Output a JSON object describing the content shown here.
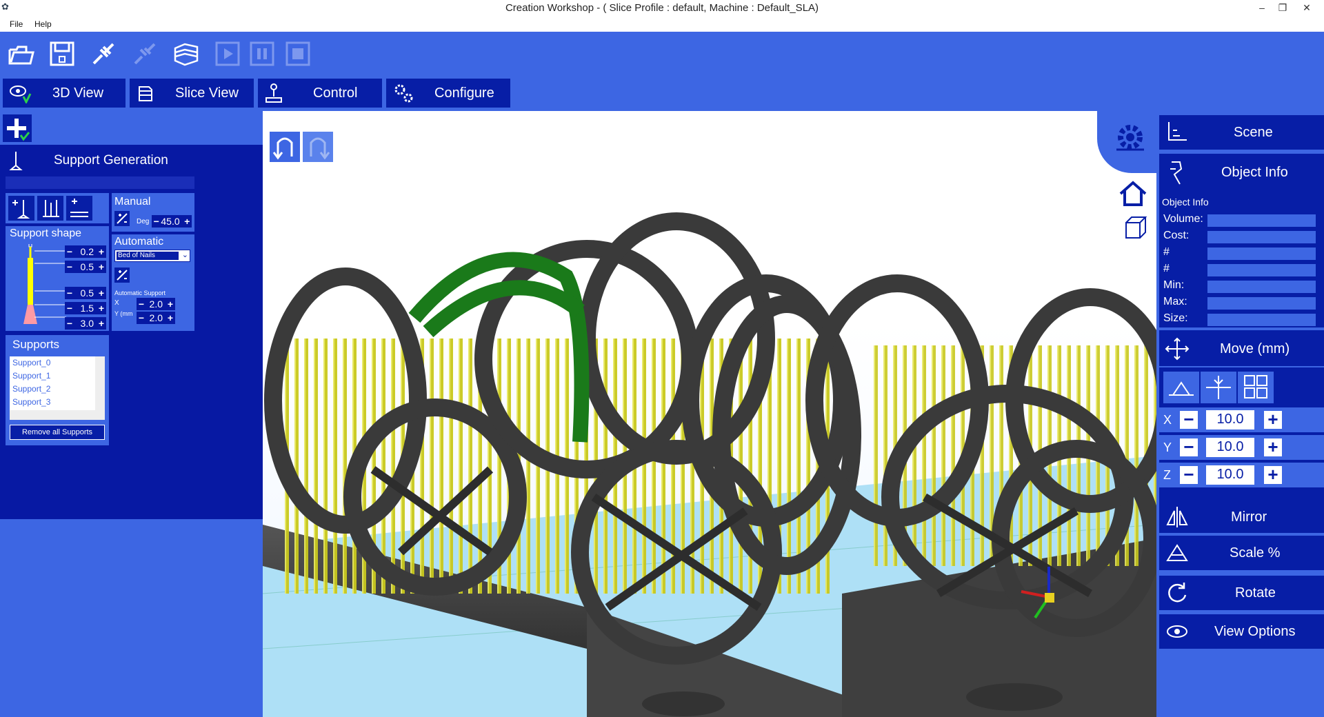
{
  "window": {
    "title": "Creation Workshop -    ( Slice Profile : default, Machine : Default_SLA)",
    "min": "–",
    "max": "❐",
    "close": "✕"
  },
  "menu": [
    "File",
    "Help"
  ],
  "toolbar": [
    {
      "icon": "open-folder-icon"
    },
    {
      "icon": "save-icon"
    },
    {
      "icon": "connect-icon"
    },
    {
      "icon": "disconnect-icon"
    },
    {
      "icon": "slice-icon"
    },
    {
      "icon": "play-icon"
    },
    {
      "icon": "pause-icon"
    },
    {
      "icon": "stop-icon"
    }
  ],
  "tabs": [
    "3D View",
    "Slice View",
    "Control",
    "Configure"
  ],
  "support": {
    "title": "Support Generation",
    "manual_label": "Manual",
    "deg_label": "Deg",
    "deg_value": "45.0",
    "shape_title": "Support shape",
    "shape_values": [
      "0.2",
      "0.5",
      "0.5",
      "1.5",
      "3.0"
    ],
    "automatic_label": "Automatic",
    "auto_option": "Bed of Nails",
    "auto_support_label": "Automatic Support",
    "x_label": "X",
    "y_label": "Y (mm",
    "x_value": "2.0",
    "y_value": "2.0",
    "supports_title": "Supports",
    "supports_list": [
      "Support_0",
      "Support_1",
      "Support_2",
      "Support_3"
    ],
    "remove_all": "Remove all Supports"
  },
  "right": {
    "scene": "Scene",
    "object_info": "Object Info",
    "object_info_sub": "Object Info",
    "info_labels": [
      "Volume:",
      "Cost:",
      "#",
      "#",
      "Min:",
      "Max:",
      "Size:"
    ],
    "move": "Move (mm)",
    "axes": [
      {
        "label": "X",
        "value": "10.0"
      },
      {
        "label": "Y",
        "value": "10.0"
      },
      {
        "label": "Z",
        "value": "10.0"
      }
    ],
    "mirror": "Mirror",
    "scale": "Scale %",
    "rotate": "Rotate",
    "view_options": "View Options"
  },
  "colors": {
    "panel_blue": "#3d66e3",
    "dark_blue": "#0719a3",
    "support_yellow": "#c8c81e",
    "ring_gray": "#3a3a3a",
    "selected_green": "#1a7a1a"
  }
}
